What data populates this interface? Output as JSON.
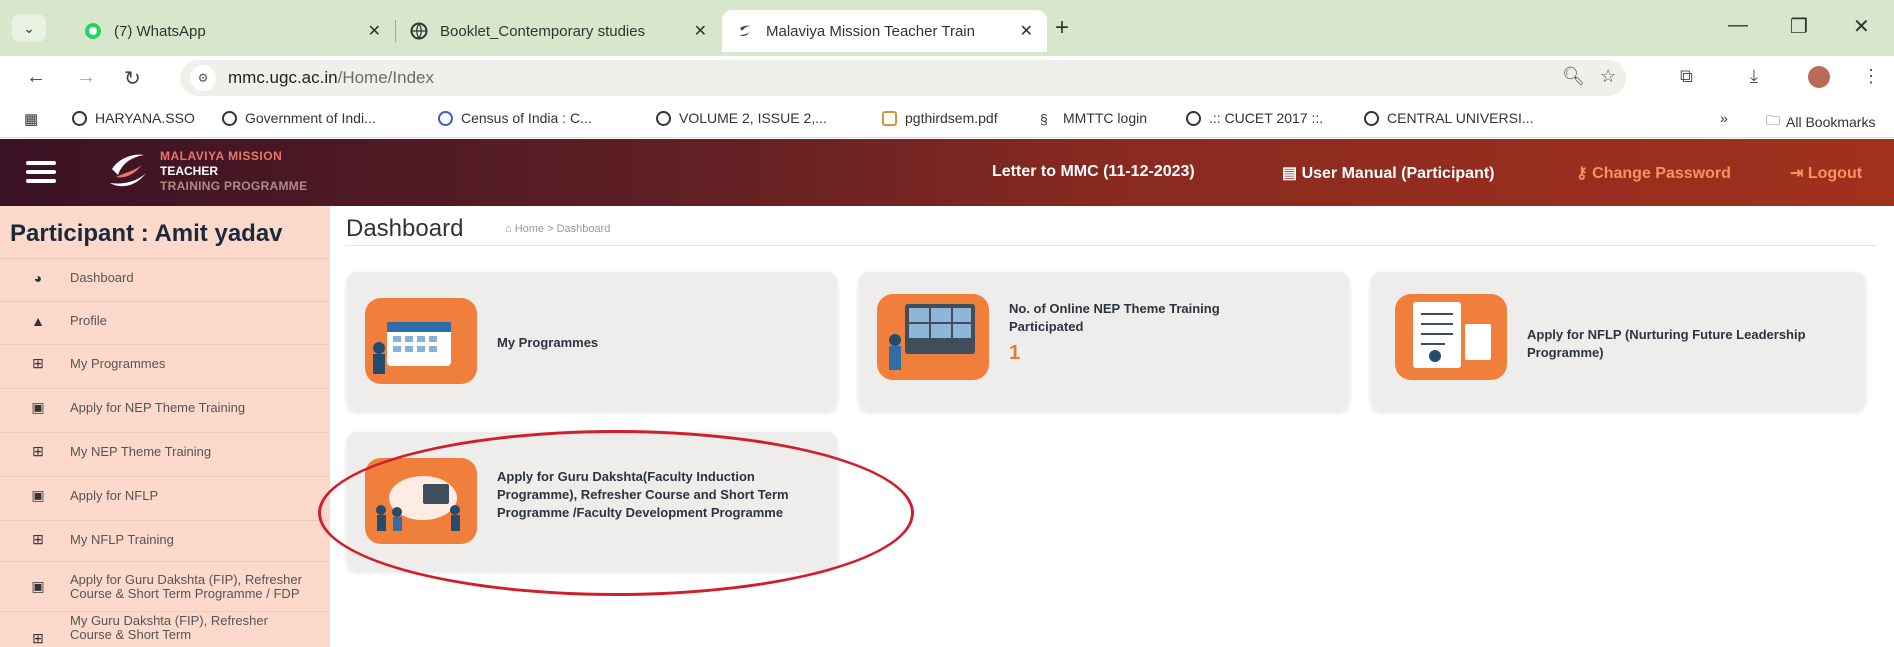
{
  "browser": {
    "tabs": [
      {
        "title": "(7) WhatsApp",
        "icon": "whatsapp-icon"
      },
      {
        "title": "Booklet_Contemporary studies",
        "icon": "globe-icon"
      },
      {
        "title": "Malaviya Mission Teacher Train",
        "icon": "mmttp-favicon"
      }
    ],
    "new_tab": "+",
    "url_host": "mmc.ugc.ac.in",
    "url_path": "/Home/Index",
    "bookmarks": [
      "HARYANA.SSO",
      "Government of Indi...",
      "Census of India : C...",
      "VOLUME 2, ISSUE 2,...",
      "pgthirdsem.pdf",
      "MMTTC login",
      ".:: CUCET 2017 ::.",
      "CENTRAL UNIVERSI..."
    ],
    "bookmarks_overflow": "»",
    "all_bookmarks": "All Bookmarks"
  },
  "header": {
    "logo_line1": "MALAVIYA MISSION",
    "logo_line2": "TEACHER",
    "logo_line3": "TRAINING PROGRAMME",
    "links": [
      "Letter to MMC (11-12-2023)",
      "User Manual (Participant)",
      "Change Password",
      "Logout"
    ]
  },
  "sidebar": {
    "title": "Participant : Amit yadav",
    "items": [
      {
        "label": "Dashboard",
        "icon": "dashboard-icon"
      },
      {
        "label": "Profile",
        "icon": "user-icon"
      },
      {
        "label": "My Programmes",
        "icon": "grid-icon"
      },
      {
        "label": "Apply for NEP Theme Training",
        "icon": "image-icon"
      },
      {
        "label": "My NEP Theme Training",
        "icon": "grid-icon"
      },
      {
        "label": "Apply for NFLP",
        "icon": "image-icon"
      },
      {
        "label": "My NFLP Training",
        "icon": "grid-icon"
      },
      {
        "label": "Apply for Guru Dakshta (FIP), Refresher Course & Short Term Programme / FDP",
        "icon": "image-icon"
      },
      {
        "label": "My Guru Dakshta (FIP), Refresher Course & Short Term",
        "icon": "grid-icon"
      }
    ]
  },
  "main": {
    "title": "Dashboard",
    "breadcrumb": "Home > Dashboard",
    "cards": [
      {
        "label": "My Programmes"
      },
      {
        "label": "No. of Online NEP Theme Training Participated",
        "count": "1"
      },
      {
        "label": "Apply for NFLP (Nurturing Future Leadership Programme)"
      },
      {
        "label": "Apply for Guru Dakshta(Faculty Induction Programme), Refresher Course and Short Term Programme /Faculty Development Programme"
      }
    ]
  },
  "colors": {
    "header_start": "#3a1224",
    "header_end": "#a1311d",
    "sidebar_bg": "#fdd9cc",
    "card_bg": "#efedeb",
    "card_icon_bg": "#f07f3c",
    "highlight_circle": "#d21e2a"
  }
}
